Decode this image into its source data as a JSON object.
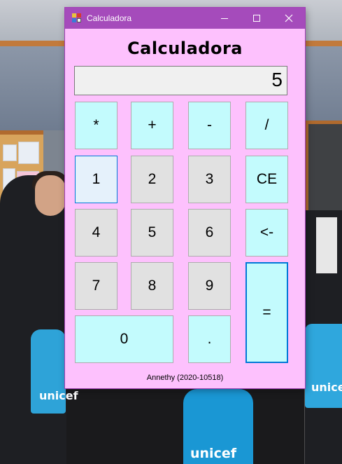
{
  "window": {
    "title": "Calculadora",
    "controls": {
      "minimize": "minimize",
      "maximize": "maximize",
      "close": "close"
    }
  },
  "heading": "Calculadora",
  "display": {
    "value": "5"
  },
  "keys": {
    "multiply": "*",
    "add": "+",
    "subtract": "-",
    "divide": "/",
    "one": "1",
    "two": "2",
    "three": "3",
    "clear": "CE",
    "four": "4",
    "five": "5",
    "six": "6",
    "backspace": "<-",
    "seven": "7",
    "eight": "8",
    "nine": "9",
    "equals": "=",
    "zero": "0",
    "decimal": "."
  },
  "footer": "Annethy (2020-10518)",
  "colors": {
    "form_background": "#fdc1fd",
    "titlebar": "#a54bbb",
    "operator_key": "#c3fbfd",
    "number_key": "#e1e1e1",
    "focus_border": "#0078d7"
  },
  "background": {
    "bag_texts": [
      "unicef",
      "unicef",
      "unicef"
    ]
  }
}
